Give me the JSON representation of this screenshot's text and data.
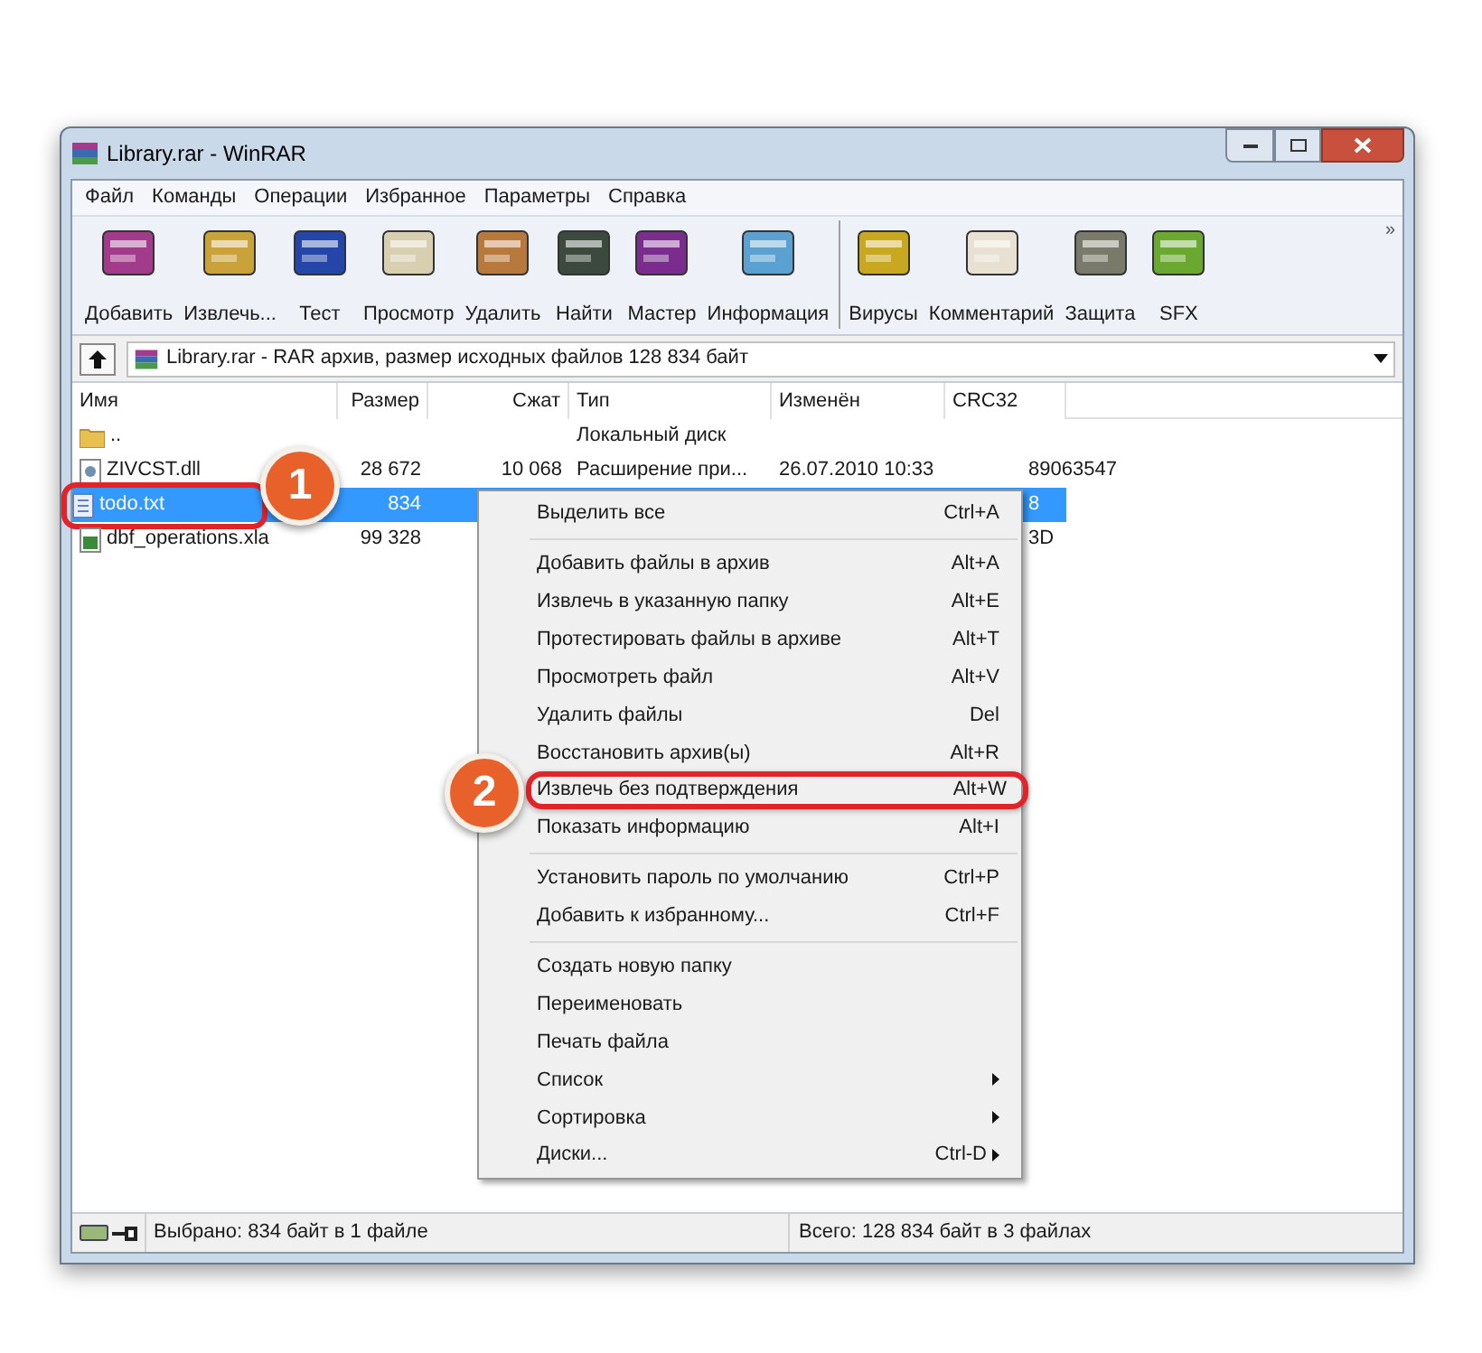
{
  "window": {
    "title": "Library.rar - WinRAR"
  },
  "menu_bar": [
    "Файл",
    "Команды",
    "Операции",
    "Избранное",
    "Параметры",
    "Справка"
  ],
  "toolbar": [
    {
      "label": "Добавить"
    },
    {
      "label": "Извлечь..."
    },
    {
      "label": "Тест"
    },
    {
      "label": "Просмотр"
    },
    {
      "label": "Удалить"
    },
    {
      "label": "Найти"
    },
    {
      "label": "Мастер"
    },
    {
      "label": "Информация"
    },
    {
      "label": "Вирусы"
    },
    {
      "label": "Комментарий"
    },
    {
      "label": "Защита"
    },
    {
      "label": "SFX"
    }
  ],
  "toolbar_more": "»",
  "address": {
    "text": "Library.rar - RAR архив, размер исходных файлов 128 834 байт"
  },
  "table": {
    "columns": [
      "Имя",
      "Размер",
      "Сжат",
      "Тип",
      "Изменён",
      "CRC32"
    ],
    "rows": [
      {
        "kind": "folder",
        "selected": false,
        "highlighted": false,
        "cells": [
          "..",
          "",
          "",
          "Локальный диск",
          "",
          ""
        ]
      },
      {
        "kind": "dll",
        "selected": false,
        "highlighted": false,
        "cells": [
          "ZIVCST.dll",
          "28 672",
          "10 068",
          "Расширение при...",
          "26.07.2010 10:33",
          "89063547"
        ]
      },
      {
        "kind": "text",
        "selected": true,
        "highlighted": true,
        "cells": [
          "todo.txt",
          "834",
          "",
          "",
          "",
          "8"
        ]
      },
      {
        "kind": "sheet",
        "selected": false,
        "highlighted": false,
        "cells": [
          "dbf_operations.xla",
          "99 328",
          "",
          "",
          "",
          "3D"
        ]
      }
    ]
  },
  "context_menu": [
    {
      "kind": "item",
      "label": "Выделить все",
      "shortcut": "Ctrl+A",
      "highlighted": false
    },
    {
      "kind": "separator"
    },
    {
      "kind": "item",
      "label": "Добавить файлы в архив",
      "shortcut": "Alt+A",
      "highlighted": false
    },
    {
      "kind": "item",
      "label": "Извлечь в указанную папку",
      "shortcut": "Alt+E",
      "highlighted": false
    },
    {
      "kind": "item",
      "label": "Протестировать файлы в архиве",
      "shortcut": "Alt+T",
      "highlighted": false
    },
    {
      "kind": "item",
      "label": "Просмотреть файл",
      "shortcut": "Alt+V",
      "highlighted": false
    },
    {
      "kind": "item",
      "label": "Удалить файлы",
      "shortcut": "Del",
      "highlighted": false
    },
    {
      "kind": "item",
      "label": "Восстановить архив(ы)",
      "shortcut": "Alt+R",
      "highlighted": false
    },
    {
      "kind": "item",
      "label": "Извлечь без подтверждения",
      "shortcut": "Alt+W",
      "highlighted": true
    },
    {
      "kind": "item",
      "label": "Показать информацию",
      "shortcut": "Alt+I",
      "highlighted": false
    },
    {
      "kind": "separator"
    },
    {
      "kind": "item",
      "label": "Установить пароль по умолчанию",
      "shortcut": "Ctrl+P",
      "highlighted": false
    },
    {
      "kind": "item",
      "label": "Добавить к избранному...",
      "shortcut": "Ctrl+F",
      "highlighted": false
    },
    {
      "kind": "separator"
    },
    {
      "kind": "item",
      "label": "Создать новую папку",
      "highlighted": false
    },
    {
      "kind": "item",
      "label": "Переименовать",
      "highlighted": false
    },
    {
      "kind": "item",
      "label": "Печать файла",
      "highlighted": false
    },
    {
      "kind": "submenu",
      "label": "Список",
      "highlighted": false
    },
    {
      "kind": "submenu",
      "label": "Сортировка",
      "highlighted": false
    },
    {
      "kind": "submenu",
      "label": "Диски...",
      "shortcut": "Ctrl-D",
      "highlighted": false
    }
  ],
  "status_bar": {
    "left": "Выбрано: 834 байт в 1 файле",
    "right": "Всего: 128 834 байт в 3 файлах"
  },
  "callouts": [
    {
      "number": "1"
    },
    {
      "number": "2"
    }
  ]
}
